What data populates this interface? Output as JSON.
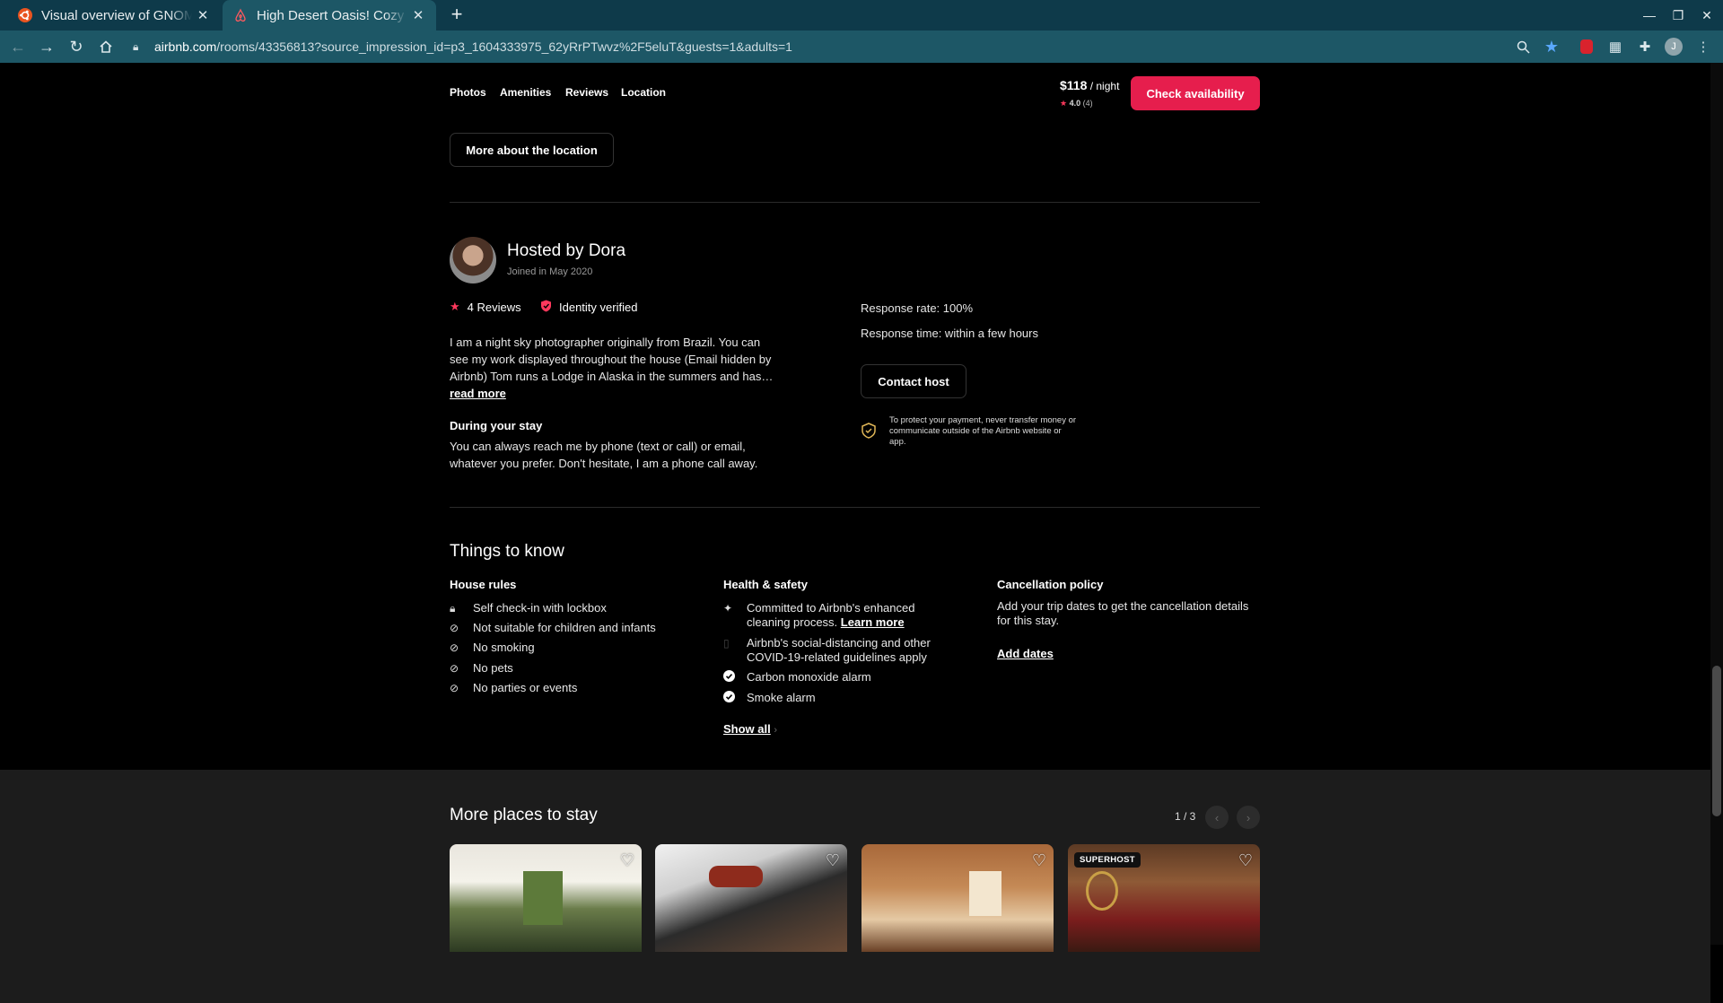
{
  "browser": {
    "tabs": [
      {
        "title": "Visual overview of GNOME",
        "icon": "ubuntu-icon"
      },
      {
        "title": "High Desert Oasis! Cozy home",
        "icon": "airbnb-icon",
        "active": true
      }
    ],
    "new_tab": "+",
    "url_domain": "airbnb.com",
    "url_path": "/rooms/43356813?source_impression_id=p3_1604333975_62yRrPTwvz%2F5eluT&guests=1&adults=1",
    "profile_initial": "J"
  },
  "subnav": {
    "links": [
      "Photos",
      "Amenities",
      "Reviews",
      "Location"
    ]
  },
  "booking": {
    "price": "$118",
    "per_night": " / night",
    "rating": "4.0",
    "review_count": "(4)",
    "check_label": "Check availability"
  },
  "location_button": "More about the location",
  "host": {
    "name": "Hosted by Dora",
    "joined": "Joined in May 2020",
    "reviews": "4 Reviews",
    "identity": "Identity verified",
    "bio": "I am a night sky photographer originally from Brazil. You can see my work displayed throughout the house (Email hidden by Airbnb) Tom runs a Lodge in Alaska in the summers and has…",
    "read_more": "read more",
    "during_title": "During your stay",
    "during_text": "You can always reach me by phone (text or call) or email, whatever you prefer. Don't hesitate, I am a phone call away.",
    "response_rate": "Response rate: 100%",
    "response_time": "Response time: within a few hours",
    "contact_label": "Contact host",
    "payment_note": "To protect your payment, never transfer money or communicate outside of the Airbnb website or app."
  },
  "things": {
    "title": "Things to know",
    "house_rules": {
      "title": "House rules",
      "items": [
        "Self check-in with lockbox",
        "Not suitable for children and infants",
        "No smoking",
        "No pets",
        "No parties or events"
      ]
    },
    "health": {
      "title": "Health & safety",
      "item1": "Committed to Airbnb's enhanced cleaning process.",
      "learn_more": "Learn more",
      "item2": "Airbnb's social-distancing and other COVID-19-related guidelines apply",
      "item3": "Carbon monoxide alarm",
      "item4": "Smoke alarm",
      "show_all": "Show all"
    },
    "cancellation": {
      "title": "Cancellation policy",
      "text": "Add your trip dates to get the cancellation details for this stay.",
      "add_dates": "Add dates"
    }
  },
  "more_places": {
    "title": "More places to stay",
    "page": "1 / 3",
    "superhost_badge": "SUPERHOST"
  }
}
